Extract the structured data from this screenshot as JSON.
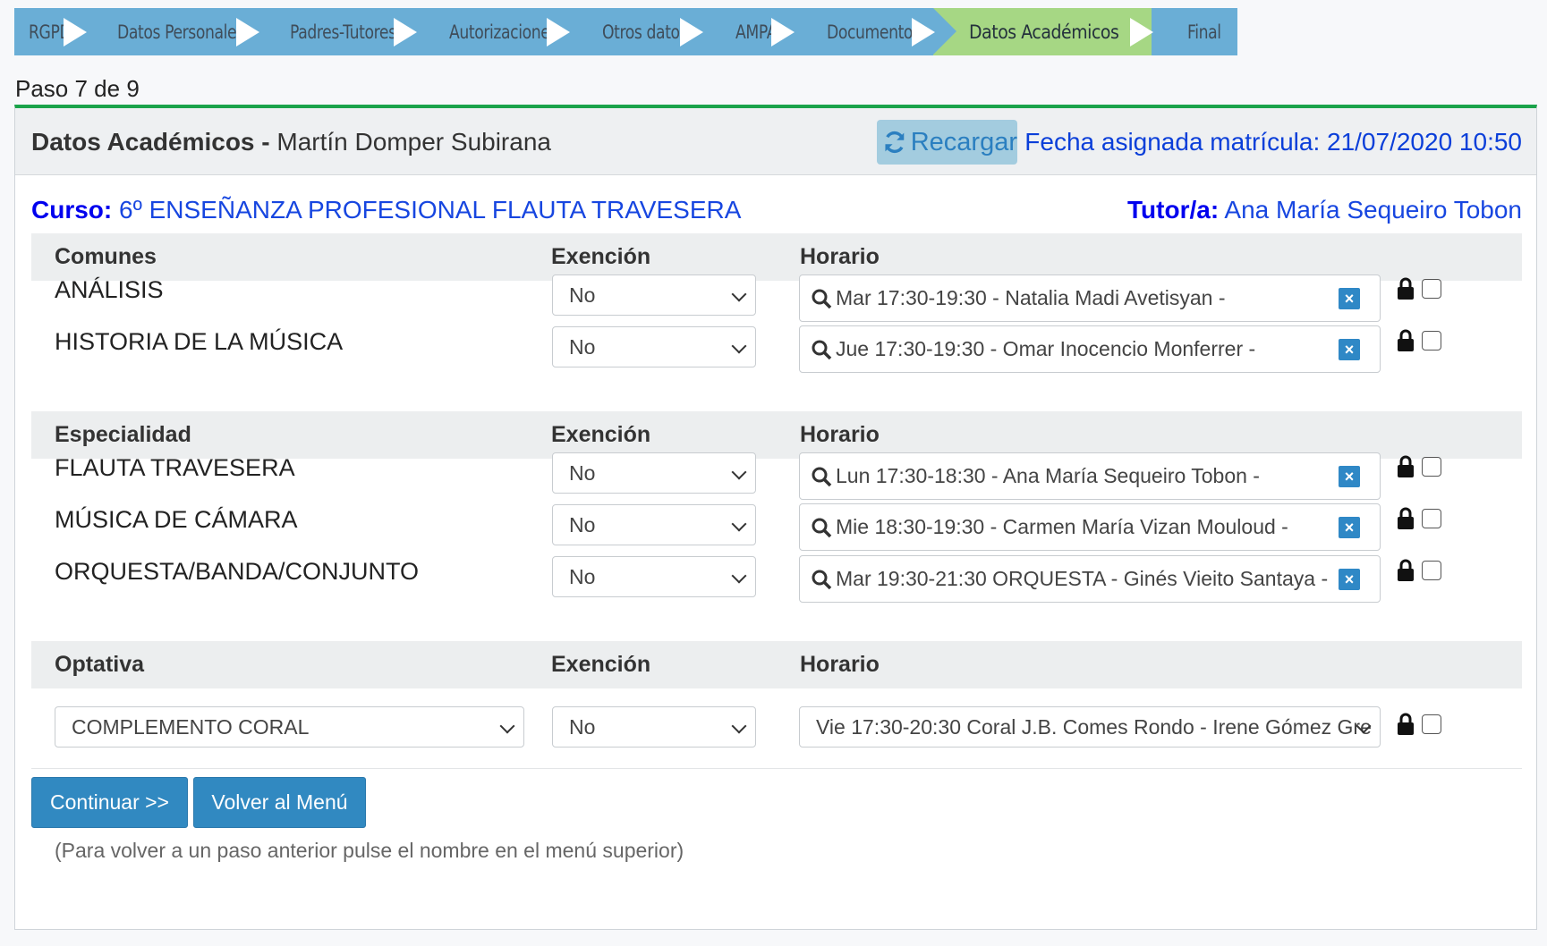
{
  "wizard": {
    "steps": [
      {
        "label": "RGPD"
      },
      {
        "label": "Datos Personales"
      },
      {
        "label": "Padres-Tutores"
      },
      {
        "label": "Autorizaciones"
      },
      {
        "label": "Otros datos"
      },
      {
        "label": "AMPA"
      },
      {
        "label": "Documentos"
      },
      {
        "label": "Datos Académicos"
      },
      {
        "label": "Final"
      }
    ]
  },
  "paso": "Paso 7 de 9",
  "panel": {
    "title_bold": "Datos Académicos -",
    "title_name": "Martín Domper Subirana",
    "reload_label": "Recargar",
    "fecha": "Fecha asignada matrícula: 21/07/2020 10:50"
  },
  "curso": {
    "label": "Curso:",
    "value": "6º ENSEÑANZA PROFESIONAL FLAUTA TRAVESERA"
  },
  "tutor": {
    "label": "Tutor/a:",
    "value": "Ana María Sequeiro Tobon"
  },
  "sections": {
    "comunes": {
      "headers": [
        "Comunes",
        "Exención",
        "Horario"
      ],
      "rows": [
        {
          "subject": "ANÁLISIS",
          "exencion": "No",
          "horario": "Mar 17:30-19:30 - Natalia Madi Avetisyan -"
        },
        {
          "subject": "HISTORIA DE LA MÚSICA",
          "exencion": "No",
          "horario": "Jue 17:30-19:30 - Omar Inocencio Monferrer -"
        }
      ]
    },
    "especialidad": {
      "headers": [
        "Especialidad",
        "Exención",
        "Horario"
      ],
      "rows": [
        {
          "subject": "FLAUTA TRAVESERA",
          "exencion": "No",
          "horario": "Lun 17:30-18:30 - Ana María Sequeiro Tobon -"
        },
        {
          "subject": "MÚSICA DE CÁMARA",
          "exencion": "No",
          "horario": "Mie 18:30-19:30 - Carmen María Vizan Mouloud -"
        },
        {
          "subject": "ORQUESTA/BANDA/CONJUNTO",
          "exencion": "No",
          "horario": "Mar 19:30-21:30 ORQUESTA - Ginés Vieito Santaya -"
        }
      ]
    },
    "optativa": {
      "headers": [
        "Optativa",
        "Exención",
        "Horario"
      ],
      "row": {
        "subject": "COMPLEMENTO CORAL",
        "exencion": "No",
        "horario": "Vie 17:30-20:30 Coral J.B. Comes Rondo - Irene Gómez Gre"
      }
    }
  },
  "buttons": {
    "continuar": "Continuar >>",
    "volver": "Volver al Menú"
  },
  "hint": "(Para volver a un paso anterior pulse el nombre en el menú superior)",
  "icons": {
    "reload": "refresh-icon",
    "search": "search-icon",
    "clear": "clear-x-icon",
    "lock": "lock-icon"
  },
  "colors": {
    "wizard_step": "#6aaed6",
    "wizard_active": "#a6d784",
    "primary": "#3189c1",
    "link_blue": "#0000ee",
    "panel_border_top": "#1aa34a"
  }
}
